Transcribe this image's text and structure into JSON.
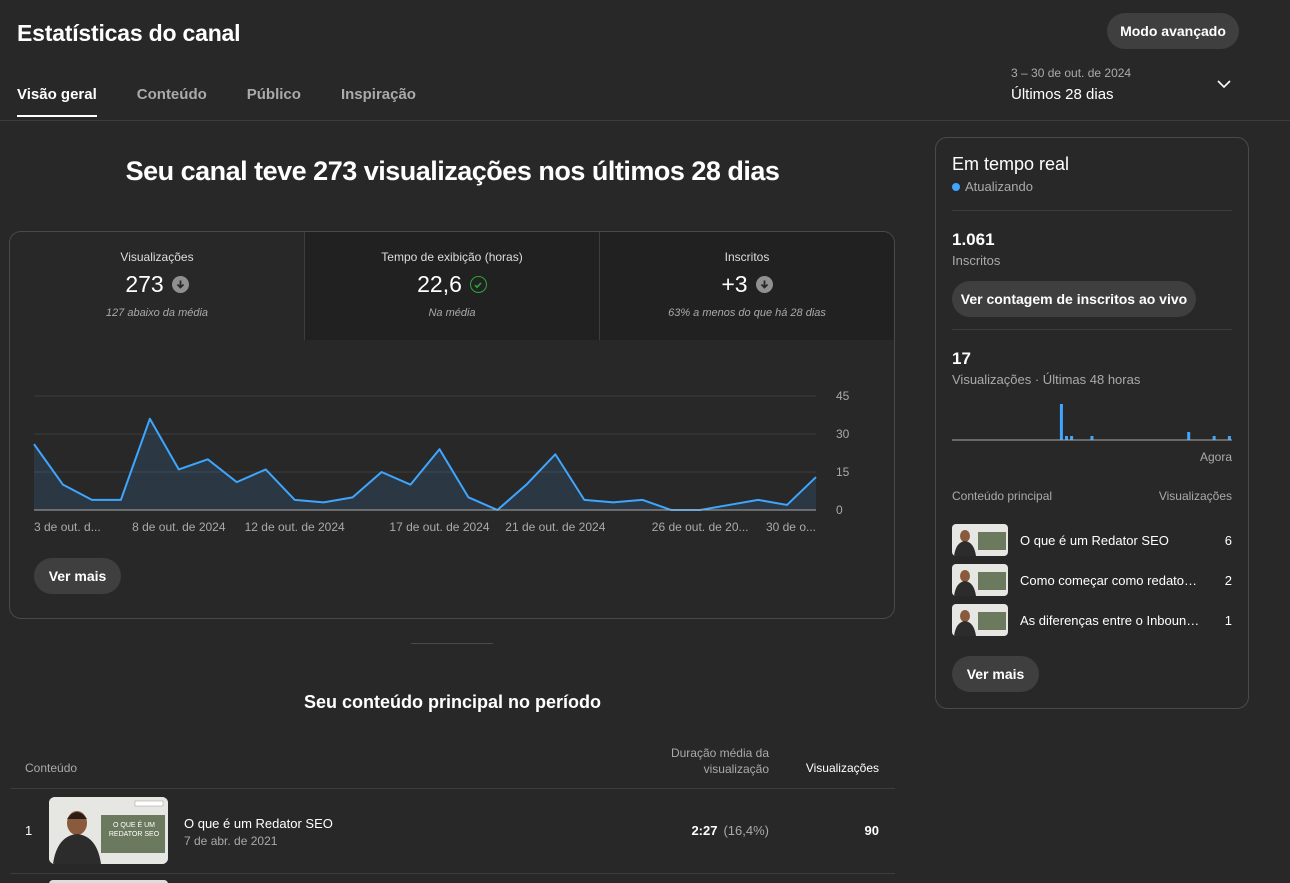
{
  "header": {
    "title": "Estatísticas do canal",
    "advanced_button": "Modo avançado",
    "tabs": [
      {
        "label": "Visão geral",
        "active": true
      },
      {
        "label": "Conteúdo",
        "active": false
      },
      {
        "label": "Público",
        "active": false
      },
      {
        "label": "Inspiração",
        "active": false
      }
    ],
    "date_range": {
      "dates": "3 – 30 de out. de 2024",
      "label": "Últimos 28 dias"
    }
  },
  "overview": {
    "headline": "Seu canal teve 273 visualizações nos últimos 28 dias",
    "metrics": [
      {
        "label": "Visualizações",
        "value": "273",
        "note": "127 abaixo da média",
        "status_icon": "arrow-down-icon"
      },
      {
        "label": "Tempo de exibição (horas)",
        "value": "22,6",
        "note": "Na média",
        "status_icon": "check-circle-icon"
      },
      {
        "label": "Inscritos",
        "value": "+3",
        "note": "63% a menos do que há 28 dias",
        "status_icon": "arrow-down-icon"
      }
    ],
    "more_button": "Ver mais"
  },
  "chart_data": {
    "type": "area",
    "series": [
      {
        "values": [
          26,
          10,
          4,
          4,
          36,
          16,
          20,
          11,
          16,
          4,
          3,
          5,
          15,
          10,
          24,
          5,
          0,
          10,
          22,
          4,
          3,
          4,
          0,
          0,
          2,
          4,
          2,
          13
        ]
      }
    ],
    "x_tick_labels": [
      "3 de out. d...",
      "8 de out. de 2024",
      "12 de out. de 2024",
      "17 de out. de 2024",
      "21 de out. de 2024",
      "26 de out. de 20...",
      "30 de o..."
    ],
    "y_ticks": [
      0,
      15,
      30,
      45
    ],
    "ylim": [
      0,
      45
    ],
    "grid": true,
    "line_color": "#3ea6ff"
  },
  "top_content": {
    "title": "Seu conteúdo principal no período",
    "columns": {
      "content": "Conteúdo",
      "duration": "Duração média da visualização",
      "views": "Visualizações"
    },
    "rows": [
      {
        "rank": "1",
        "title": "O que é um Redator SEO",
        "date": "7 de abr. de 2021",
        "duration": "2:27",
        "pct": "(16,4%)",
        "views": "90",
        "thumb_text": "O QUE É UM REDATOR SEO"
      }
    ]
  },
  "realtime": {
    "title": "Em tempo real",
    "status": "Atualizando",
    "subscribers": {
      "value": "1.061",
      "label": "Inscritos"
    },
    "live_button": "Ver contagem de inscritos ao vivo",
    "views": {
      "value": "17",
      "label": "Visualizações · Últimas 48 horas"
    },
    "mini_chart_values": [
      0,
      0,
      0,
      0,
      0,
      0,
      0,
      0,
      0,
      0,
      0,
      0,
      0,
      0,
      0,
      0,
      0,
      0,
      0,
      0,
      0,
      9,
      1,
      1,
      0,
      0,
      0,
      1,
      0,
      0,
      0,
      0,
      0,
      0,
      0,
      0,
      0,
      0,
      0,
      0,
      0,
      0,
      0,
      0,
      0,
      0,
      2,
      0,
      0,
      0,
      0,
      1,
      0,
      0,
      1
    ],
    "now_label": "Agora",
    "list_header": {
      "left": "Conteúdo principal",
      "right": "Visualizações"
    },
    "items": [
      {
        "title": "O que é um Redator SEO",
        "views": "6"
      },
      {
        "title": "Como começar como redator freelancer",
        "views": "2"
      },
      {
        "title": "As diferenças entre o Inbound Marketing e o Outbound",
        "views": "1"
      }
    ],
    "more_button": "Ver mais"
  }
}
